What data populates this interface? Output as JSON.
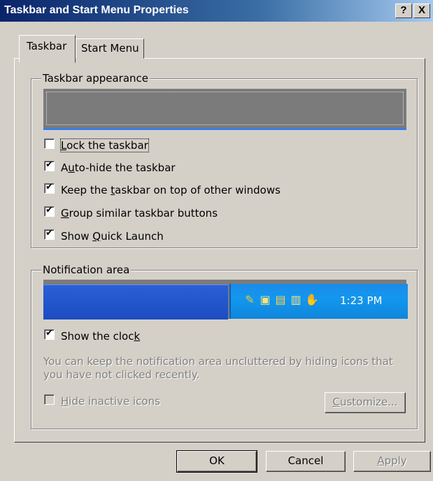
{
  "window": {
    "title": "Taskbar and Start Menu Properties",
    "help_label": "?",
    "close_label": "X"
  },
  "tabs": [
    {
      "label": "Taskbar",
      "active": true
    },
    {
      "label": "Start Menu",
      "active": false
    }
  ],
  "appearance": {
    "legend": "Taskbar appearance",
    "options": [
      {
        "pre": "",
        "accel": "L",
        "post": "ock the taskbar",
        "checked": false
      },
      {
        "pre": "A",
        "accel": "u",
        "post": "to-hide the taskbar",
        "checked": true
      },
      {
        "pre": "Keep the ",
        "accel": "t",
        "post": "askbar on top of other windows",
        "checked": true
      },
      {
        "pre": "",
        "accel": "G",
        "post": "roup similar taskbar buttons",
        "checked": true
      },
      {
        "pre": "Show ",
        "accel": "Q",
        "post": "uick Launch",
        "checked": true
      }
    ]
  },
  "notification": {
    "legend": "Notification area",
    "time": "1:23 PM",
    "show_clock": {
      "pre": "Show the cloc",
      "accel": "k",
      "post": "",
      "checked": true
    },
    "description": "You can keep the notification area uncluttered by hiding icons that you have not clicked recently.",
    "hide_inactive": {
      "pre": "",
      "accel": "H",
      "post": "ide inactive icons",
      "checked": false
    },
    "customize_button": {
      "pre": "",
      "accel": "C",
      "post": "ustomize..."
    }
  },
  "buttons": {
    "ok": "OK",
    "cancel": "Cancel",
    "apply": {
      "pre": "",
      "accel": "A",
      "post": "pply"
    }
  },
  "colors": {
    "face": "#d4d0c8",
    "title_start": "#0a246a",
    "title_end": "#a6caf0",
    "tray_blue": "#1397ee",
    "taskbar_blue": "#2355cc"
  },
  "icons": [
    "paint-tray-icon",
    "network-tray-icon",
    "monitor-tray-icon",
    "book-tray-icon",
    "hand-tray-icon"
  ]
}
